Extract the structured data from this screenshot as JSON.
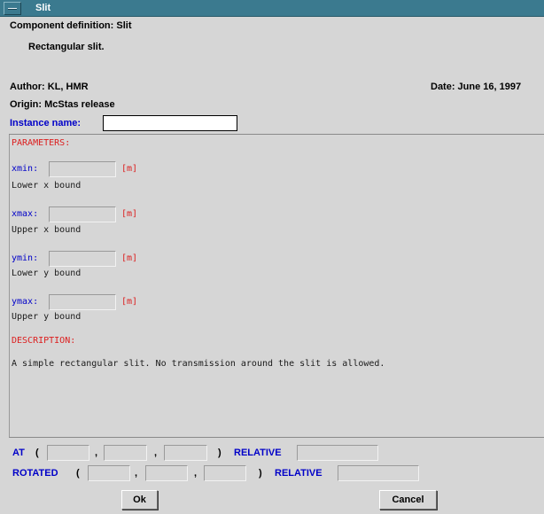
{
  "window": {
    "title": "Slit"
  },
  "header": {
    "component_definition": "Component definition: Slit",
    "short_description": "Rectangular slit.",
    "author": "Author:  KL, HMR",
    "date": "Date:  June 16, 1997",
    "origin": "Origin:  McStas release",
    "instance_label": "Instance name:",
    "instance_value": ""
  },
  "parameters": {
    "heading": "PARAMETERS:",
    "items": [
      {
        "name": "xmin:",
        "unit": "[m]",
        "desc": "Lower x bound",
        "value": ""
      },
      {
        "name": "xmax:",
        "unit": "[m]",
        "desc": "Upper x bound",
        "value": ""
      },
      {
        "name": "ymin:",
        "unit": "[m]",
        "desc": "Lower y bound",
        "value": ""
      },
      {
        "name": "ymax:",
        "unit": "[m]",
        "desc": "Upper y bound",
        "value": ""
      }
    ],
    "description_heading": "DESCRIPTION:",
    "description": "A simple rectangular slit. No transmission around the slit is allowed."
  },
  "placement": {
    "at_label": "AT",
    "rotated_label": "ROTATED",
    "relative_label": "RELATIVE",
    "open_paren": "(",
    "close_paren": ")",
    "comma": ","
  },
  "buttons": {
    "ok": "Ok",
    "cancel": "Cancel"
  },
  "icons": {
    "window_menu": "window-menu-icon"
  },
  "colors": {
    "title_bar": "#3b7a8f",
    "label_blue": "#0000c8",
    "heading_red": "#dc1e1e",
    "background": "#d6d6d6"
  }
}
